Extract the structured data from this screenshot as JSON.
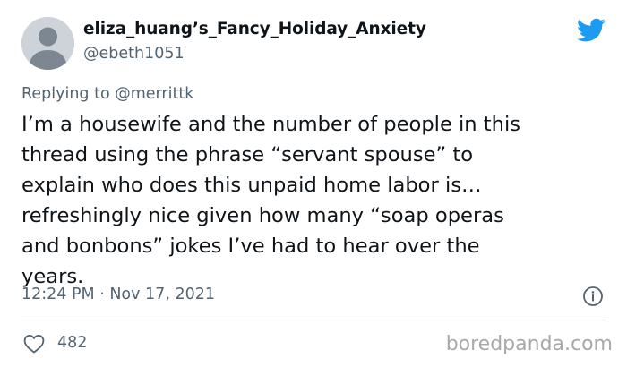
{
  "author": {
    "display_name": "eliza_huang’s_Fancy_Holiday_Anxiety",
    "handle": "@ebeth1051",
    "avatar_icon": "default-avatar-icon"
  },
  "reply": {
    "prefix": "Replying to ",
    "mention": "@merrittk"
  },
  "tweet": {
    "lines": [
      "I’m a housewife and the number of people in this",
      "thread using the phrase “servant spouse” to",
      "explain who does this unpaid home labor is…",
      "refreshingly nice given how many “soap operas",
      "and bonbons” jokes I’ve had to hear over the",
      "years."
    ]
  },
  "meta": {
    "timestamp": "12:24 PM · Nov 17, 2021"
  },
  "actions": {
    "likes": "482"
  },
  "watermark": "boredpanda.com",
  "colors": {
    "twitter_blue": "#1d9bf0",
    "secondary_text": "#536471",
    "primary_text": "#0f1419",
    "watermark": "#a9a9a9"
  }
}
